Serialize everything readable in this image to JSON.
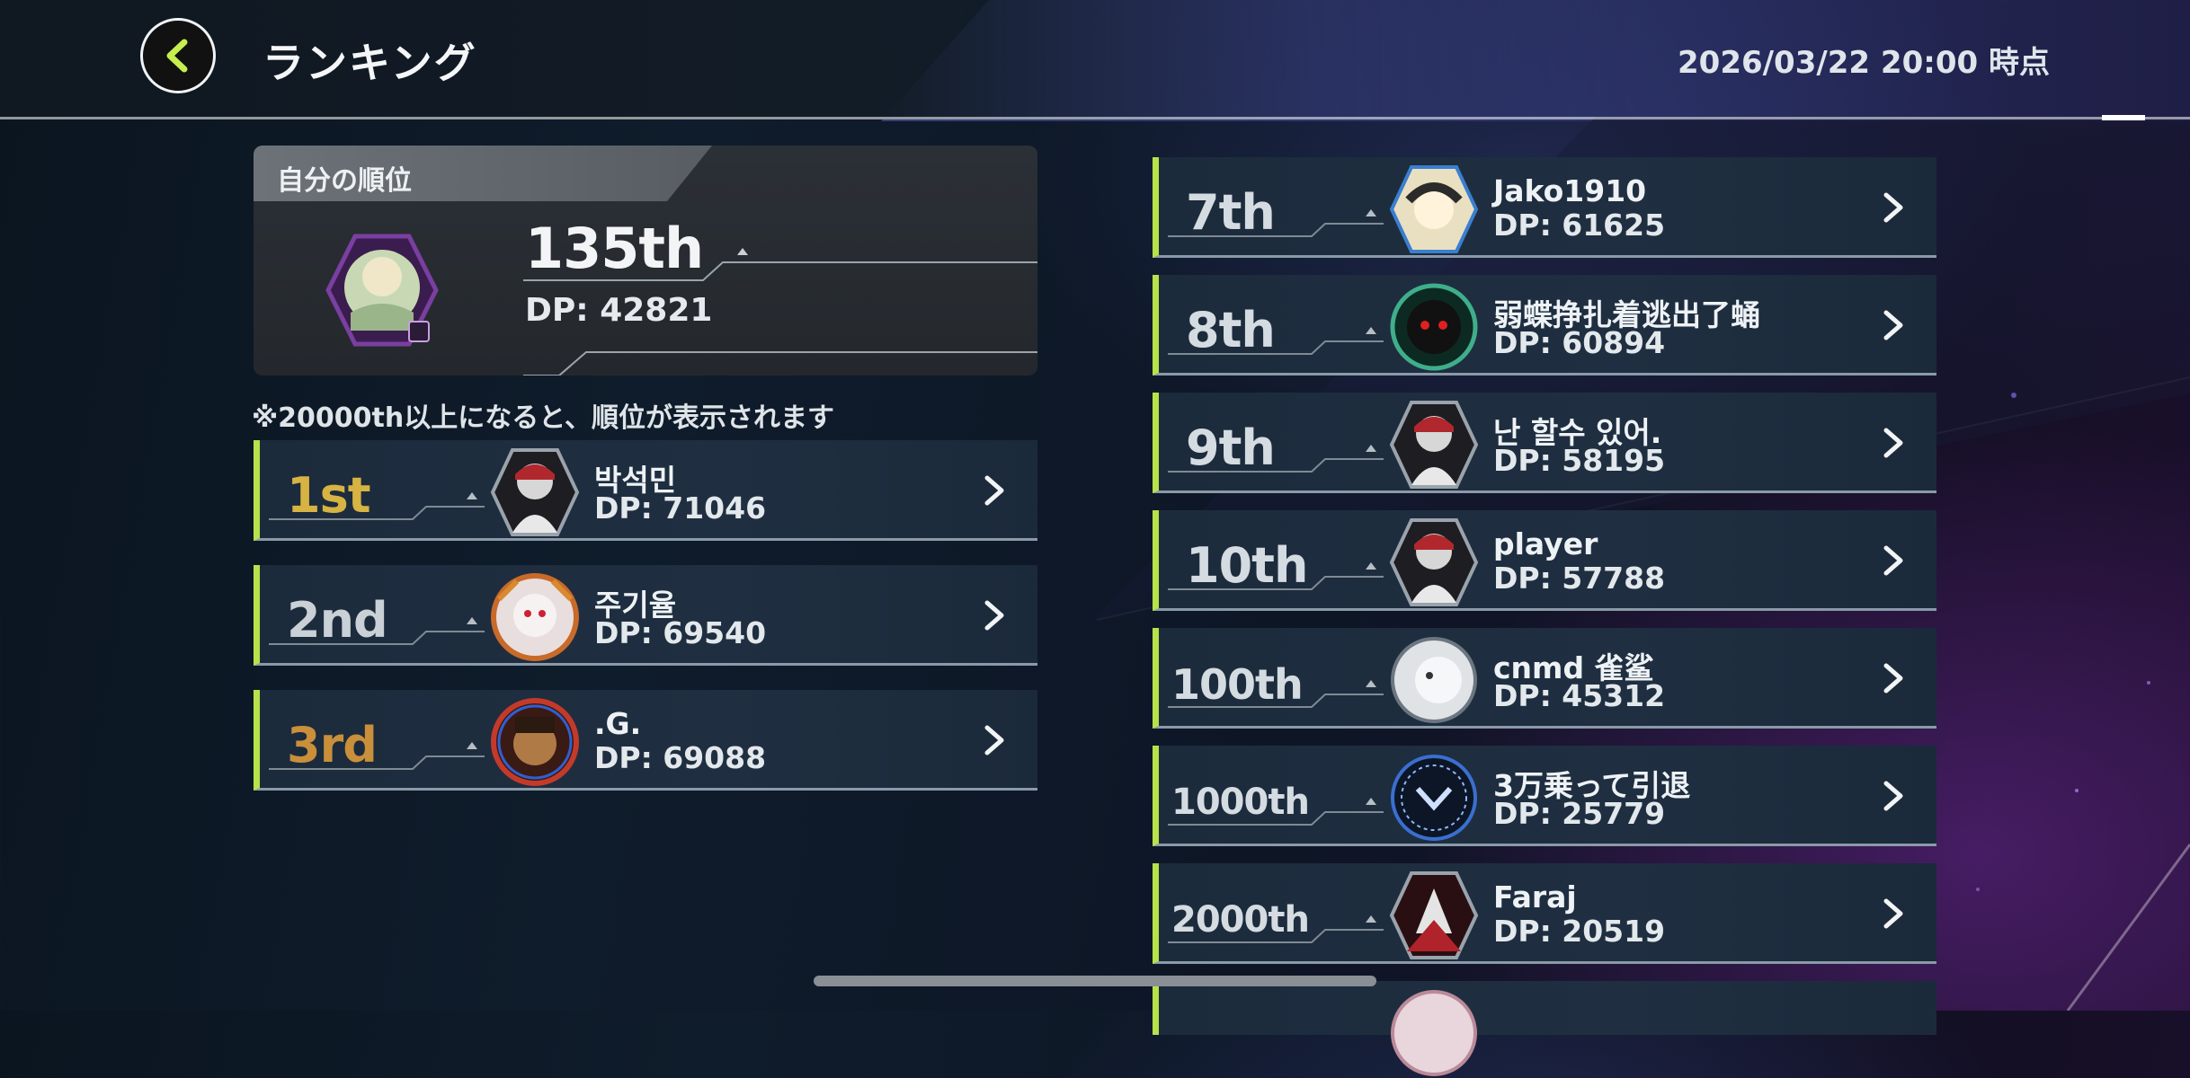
{
  "header": {
    "title": "ランキング",
    "timestamp": "2026/03/22 20:00 時点",
    "back_icon": "chevron-left-icon"
  },
  "my_rank": {
    "label": "自分の順位",
    "rank": "135th",
    "dp": "DP: 42821"
  },
  "note": "※20000th以上になると、順位が表示されます",
  "colors": {
    "accent": "#b7e24a",
    "gold": "#d6b343",
    "silver": "#c9d0d6",
    "bronze": "#c98f3a"
  },
  "left_rows": [
    {
      "rank": "1st",
      "name": "박석민",
      "dp": "DP: 71046"
    },
    {
      "rank": "2nd",
      "name": "주기율",
      "dp": "DP: 69540"
    },
    {
      "rank": "3rd",
      "name": ".G.",
      "dp": "DP: 69088"
    }
  ],
  "right_rows": [
    {
      "rank": "7th",
      "name": "Jako1910",
      "dp": "DP: 61625"
    },
    {
      "rank": "8th",
      "name": "弱蝶挣扎着逃出了蛹",
      "dp": "DP: 60894"
    },
    {
      "rank": "9th",
      "name": "난 할수 있어.",
      "dp": "DP: 58195"
    },
    {
      "rank": "10th",
      "name": "player",
      "dp": "DP: 57788"
    },
    {
      "rank": "100th",
      "name": "cnmd 雀鲨",
      "dp": "DP: 45312"
    },
    {
      "rank": "1000th",
      "name": "3万乗って引退",
      "dp": "DP: 25779"
    },
    {
      "rank": "2000th",
      "name": "Faraj",
      "dp": "DP: 20519"
    },
    {
      "rank": "",
      "name": "",
      "dp": ""
    }
  ]
}
